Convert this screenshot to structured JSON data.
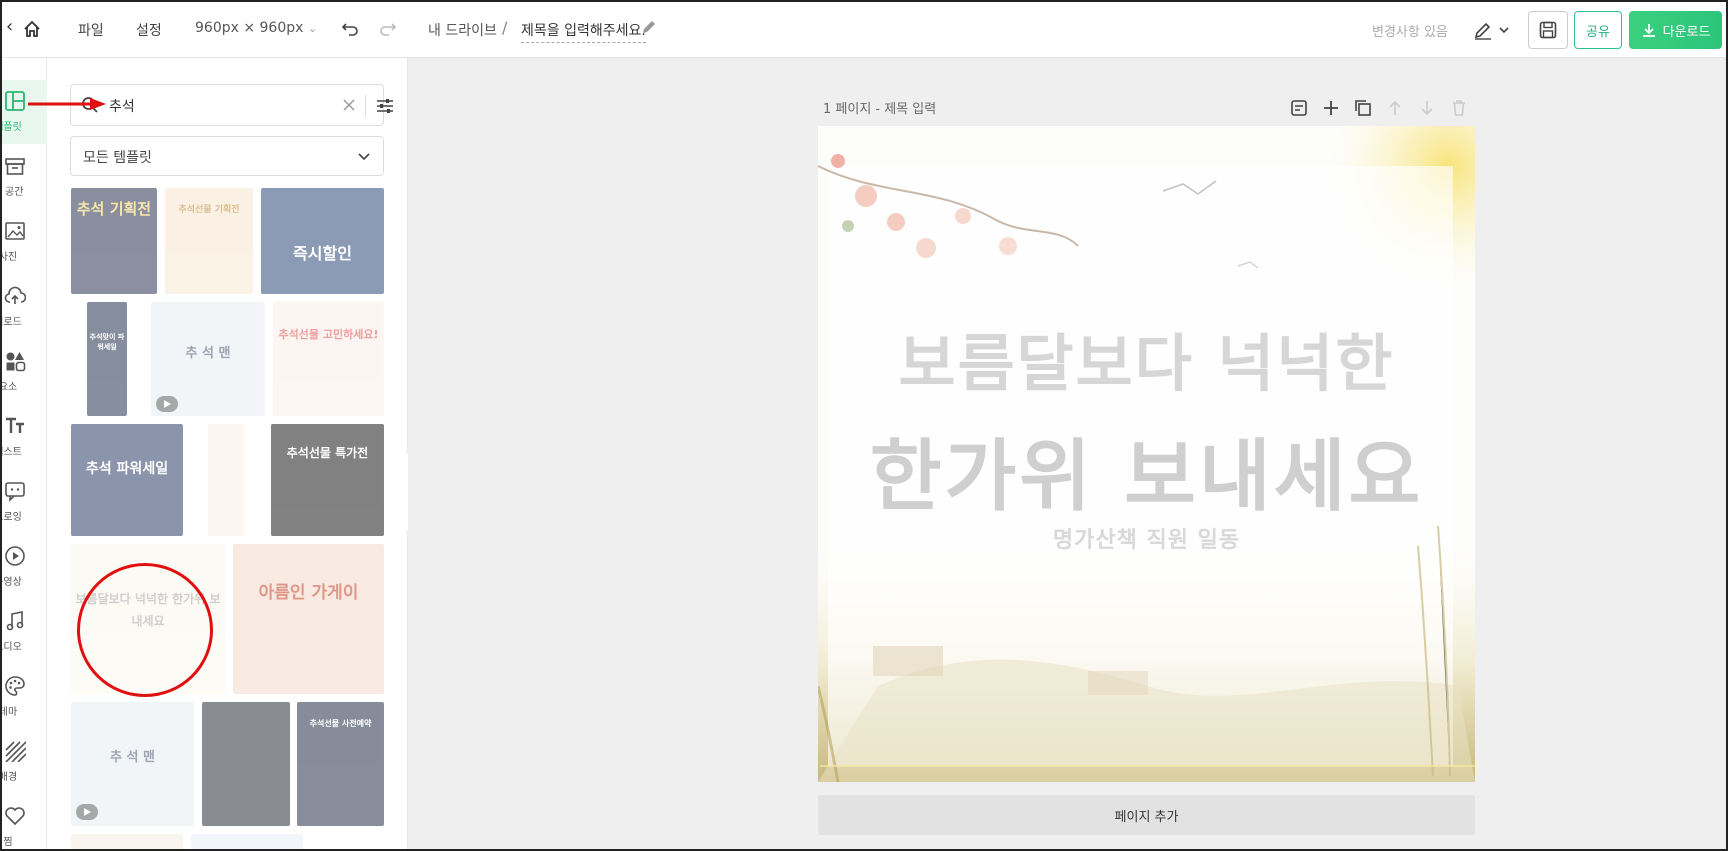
{
  "topbar": {
    "file_menu": "파일",
    "settings_menu": "설정",
    "canvas_size": "960px × 960px",
    "breadcrumb_root": "내 드라이브",
    "breadcrumb_sep": "/",
    "doc_title": "제목을 입력해주세요.",
    "save_status": "변경사항 있음",
    "share_label": "공유",
    "download_label": "다운로드"
  },
  "rail": {
    "items": [
      {
        "label": "템플릿",
        "icon": "layout-icon"
      },
      {
        "label": "업 공간",
        "icon": "archive-icon"
      },
      {
        "label": "사진",
        "icon": "image-icon"
      },
      {
        "label": "업로드",
        "icon": "cloud-upload-icon"
      },
      {
        "label": "요소",
        "icon": "shapes-icon"
      },
      {
        "label": "텍스트",
        "icon": "text-icon"
      },
      {
        "label": "드로잉",
        "icon": "chat-draw-icon"
      },
      {
        "label": "동영상",
        "icon": "play-icon"
      },
      {
        "label": "오디오",
        "icon": "music-icon"
      },
      {
        "label": "테마",
        "icon": "palette-icon"
      },
      {
        "label": "배경",
        "icon": "pattern-icon"
      },
      {
        "label": "찜",
        "icon": "heart-icon"
      }
    ]
  },
  "panel": {
    "search_value": "추석",
    "template_filter": "모든 템플릿",
    "thumbnails": [
      {
        "text": "추석 기획전",
        "bg": "#2a3550",
        "fg": "#f5d36b"
      },
      {
        "text": "추석선물 기획전",
        "bg": "#f6e7cf",
        "fg": "#c0893a"
      },
      {
        "text": "즉시할인",
        "bg": "#2d4b7a",
        "fg": "#ffffff"
      },
      {
        "text": "추석맞이 파워세일",
        "bg": "#24324f",
        "fg": "#ffffff"
      },
      {
        "text": "추 석 맨",
        "bg": "#e9edf3",
        "fg": "#4a5a75"
      },
      {
        "text": "추석선물 고민하세요!",
        "bg": "#fbeee8",
        "fg": "#d9534f"
      },
      {
        "text": "추석 파워세일",
        "bg": "#2c3d66",
        "fg": "#ffffff"
      },
      {
        "text": "",
        "bg": "#f7efe2",
        "fg": "#b98a4b"
      },
      {
        "text": "추석선물 특가전",
        "bg": "#1b1b1b",
        "fg": "#ffffff"
      },
      {
        "text": "보름달보다 넉넉한 한가위 보내세요",
        "bg": "#faf7ee",
        "fg": "#a9a9a9"
      },
      {
        "text": "아름인 가게이",
        "bg": "#f3d9c9",
        "fg": "#c4442b"
      },
      {
        "text": "추 석 맨",
        "bg": "#e9edf3",
        "fg": "#4a5a75"
      },
      {
        "text": "",
        "bg": "#2a2d3a",
        "fg": "#ffffff"
      },
      {
        "text": "추석선물 사전예약",
        "bg": "#253049",
        "fg": "#ffffff"
      }
    ]
  },
  "canvas": {
    "page_label": "1 페이지 - 제목 입력",
    "headline_1": "보름달보다 넉넉한",
    "headline_2": "한가위 보내세요",
    "subline": "명가산책 직원 일동",
    "add_page": "페이지 추가"
  },
  "colors": {
    "accent": "#2cc57a",
    "annotation": "#e01010"
  }
}
